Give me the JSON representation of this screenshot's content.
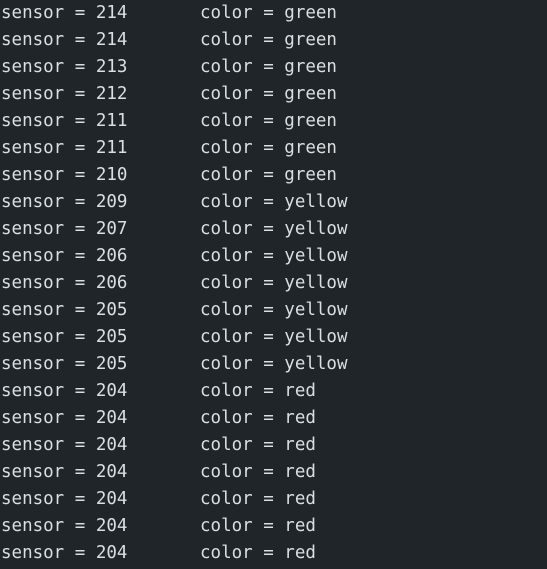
{
  "console": {
    "lines": [
      {
        "sensor": "sensor = 214",
        "color": "color = green"
      },
      {
        "sensor": "sensor = 214",
        "color": "color = green"
      },
      {
        "sensor": "sensor = 213",
        "color": "color = green"
      },
      {
        "sensor": "sensor = 212",
        "color": "color = green"
      },
      {
        "sensor": "sensor = 211",
        "color": "color = green"
      },
      {
        "sensor": "sensor = 211",
        "color": "color = green"
      },
      {
        "sensor": "sensor = 210",
        "color": "color = green"
      },
      {
        "sensor": "sensor = 209",
        "color": "color = yellow"
      },
      {
        "sensor": "sensor = 207",
        "color": "color = yellow"
      },
      {
        "sensor": "sensor = 206",
        "color": "color = yellow"
      },
      {
        "sensor": "sensor = 206",
        "color": "color = yellow"
      },
      {
        "sensor": "sensor = 205",
        "color": "color = yellow"
      },
      {
        "sensor": "sensor = 205",
        "color": "color = yellow"
      },
      {
        "sensor": "sensor = 205",
        "color": "color = yellow"
      },
      {
        "sensor": "sensor = 204",
        "color": "color = red"
      },
      {
        "sensor": "sensor = 204",
        "color": "color = red"
      },
      {
        "sensor": "sensor = 204",
        "color": "color = red"
      },
      {
        "sensor": "sensor = 204",
        "color": "color = red"
      },
      {
        "sensor": "sensor = 204",
        "color": "color = red"
      },
      {
        "sensor": "sensor = 204",
        "color": "color = red"
      },
      {
        "sensor": "sensor = 204",
        "color": "color = red"
      }
    ]
  },
  "theme": {
    "background": "#1f2529",
    "text": "#dcdfe1"
  }
}
